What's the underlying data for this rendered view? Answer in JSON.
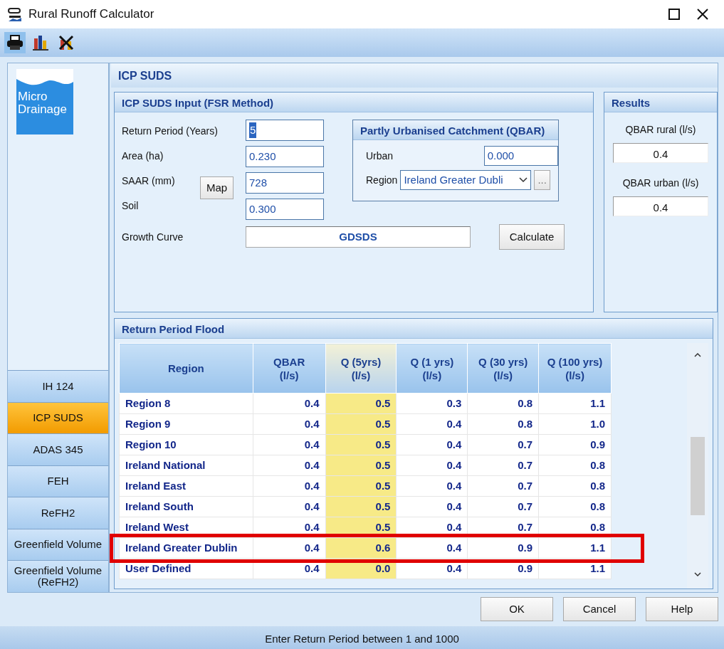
{
  "window": {
    "title": "Rural Runoff Calculator"
  },
  "logo": {
    "lines": [
      "Micro",
      "Drainage"
    ]
  },
  "sidebar": {
    "items": [
      {
        "label": "IH 124",
        "selected": false
      },
      {
        "label": "ICP SUDS",
        "selected": true
      },
      {
        "label": "ADAS 345",
        "selected": false
      },
      {
        "label": "FEH",
        "selected": false
      },
      {
        "label": "ReFH2",
        "selected": false
      },
      {
        "label": "Greenfield Volume",
        "selected": false
      },
      {
        "label": "Greenfield Volume (ReFH2)",
        "selected": false
      }
    ]
  },
  "page_title": "ICP SUDS",
  "input_panel": {
    "title": "ICP SUDS Input (FSR Method)",
    "fields": [
      {
        "label": "Return Period (Years)",
        "value": "5",
        "text_selected": true
      },
      {
        "label": "Area (ha)",
        "value": "0.230",
        "text_selected": false
      },
      {
        "label": "SAAR (mm)",
        "value": "728",
        "text_selected": false
      },
      {
        "label": "Soil",
        "value": "0.300",
        "text_selected": false
      }
    ],
    "map_button": "Map",
    "growth_curve": {
      "label": "Growth Curve",
      "value": "GDSDS"
    },
    "calculate_button": "Calculate"
  },
  "urban_panel": {
    "title": "Partly Urbanised Catchment (QBAR)",
    "urban": {
      "label": "Urban",
      "value": "0.000"
    },
    "region": {
      "label": "Region",
      "value": "Ireland Greater Dubli"
    },
    "browse_button": "..."
  },
  "results": {
    "title": "Results",
    "items": [
      {
        "label": "QBAR rural (l/s)",
        "value": "0.4"
      },
      {
        "label": "QBAR urban (l/s)",
        "value": "0.4"
      }
    ]
  },
  "flood": {
    "title": "Return Period Flood",
    "columns": [
      {
        "label": "Region",
        "highlighted": false
      },
      {
        "label": "QBAR",
        "unit": "(l/s)",
        "highlighted": false
      },
      {
        "label": "Q (5yrs)",
        "unit": "(l/s)",
        "highlighted": true
      },
      {
        "label": "Q (1 yrs)",
        "unit": "(l/s)",
        "highlighted": false
      },
      {
        "label": "Q (30 yrs)",
        "unit": "(l/s)",
        "highlighted": false
      },
      {
        "label": "Q (100 yrs)",
        "unit": "(l/s)",
        "highlighted": false
      }
    ],
    "rows": [
      {
        "cells": [
          "Region 8",
          "0.4",
          "0.5",
          "0.3",
          "0.8",
          "1.1"
        ],
        "marked": false
      },
      {
        "cells": [
          "Region 9",
          "0.4",
          "0.5",
          "0.4",
          "0.8",
          "1.0"
        ],
        "marked": false
      },
      {
        "cells": [
          "Region 10",
          "0.4",
          "0.5",
          "0.4",
          "0.7",
          "0.9"
        ],
        "marked": false
      },
      {
        "cells": [
          "Ireland National",
          "0.4",
          "0.5",
          "0.4",
          "0.7",
          "0.8"
        ],
        "marked": false
      },
      {
        "cells": [
          "Ireland East",
          "0.4",
          "0.5",
          "0.4",
          "0.7",
          "0.8"
        ],
        "marked": false
      },
      {
        "cells": [
          "Ireland South",
          "0.4",
          "0.5",
          "0.4",
          "0.7",
          "0.8"
        ],
        "marked": false
      },
      {
        "cells": [
          "Ireland West",
          "0.4",
          "0.5",
          "0.4",
          "0.7",
          "0.8"
        ],
        "marked": false
      },
      {
        "cells": [
          "Ireland Greater Dublin",
          "0.4",
          "0.6",
          "0.4",
          "0.9",
          "1.1"
        ],
        "marked": true
      },
      {
        "cells": [
          "User Defined",
          "0.4",
          "0.0",
          "0.4",
          "0.9",
          "1.1"
        ],
        "marked": false
      }
    ]
  },
  "buttons": [
    "OK",
    "Cancel",
    "Help"
  ],
  "status_bar": "Enter Return Period between 1 and 1000"
}
